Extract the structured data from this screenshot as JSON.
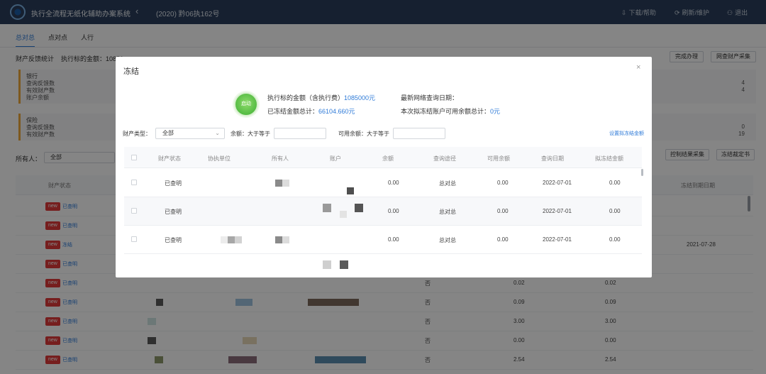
{
  "header": {
    "app_title": "执行全流程无纸化辅助办案系统",
    "case_no": "(2020) 黔06执162号",
    "actions": [
      "下载/帮助",
      "刷新/维护",
      "退出"
    ],
    "action_icons": [
      "download-icon",
      "refresh-icon",
      "user-icon"
    ]
  },
  "page": {
    "tabs": [
      "总对总",
      "点对点",
      "人行"
    ],
    "stat_label": "财产反馈统计",
    "stat_amount_prefix": "执行标的金额：10850",
    "right_buttons": [
      "完成办理",
      "网查财产采集"
    ],
    "bank_box": {
      "title": "银行",
      "lines": [
        "查询反馈数",
        "有效财产数",
        "账户余额"
      ],
      "values": [
        "4",
        "4"
      ]
    },
    "insurance_box": {
      "title": "保险",
      "lines": [
        "查询反馈数",
        "有效财产数"
      ],
      "values": [
        "0",
        "19"
      ]
    },
    "owner_label": "所有人：",
    "owner_value": "全部",
    "small_buttons": [
      "控制结果采集",
      "冻结裁定书"
    ],
    "columns": [
      "财产状态",
      "冻结到期日期"
    ],
    "badge_new": "new",
    "row_status": [
      "已查明",
      "已查明",
      "冻结",
      "已查明",
      "已查明",
      "已查明",
      "已查明",
      "已查明",
      "已查明"
    ],
    "row_date": "2021-07-28",
    "col_no": "否",
    "values_a": [
      "0.02",
      "0.09",
      "3.00",
      "0.00",
      "2.54"
    ],
    "values_b": [
      "0.02",
      "0.09",
      "3.00",
      "0.00",
      "2.54"
    ]
  },
  "modal": {
    "title": "冻结",
    "start_button": "启动",
    "target_amount_label": "执行标的金额（含执行费）",
    "target_amount": "1085000元",
    "frozen_total_label": "已冻结金额总计：",
    "frozen_total": "66104.660元",
    "latest_query_label": "最新网络查询日期：",
    "freezable_label": "本次拟冻结账户可用余额总计：",
    "freezable_total": "0元",
    "filter": {
      "type_label": "财产类型：",
      "type_value": "全部",
      "balance_label": "余额：大于等于",
      "available_label": "可用余额：大于等于",
      "set_link": "设置拟冻结金额"
    },
    "columns": [
      "财产状态",
      "协执单位",
      "所有人",
      "账户",
      "余额",
      "查询途径",
      "可用余额",
      "查询日期",
      "拟冻结金额"
    ],
    "rows": [
      {
        "status": "已查明",
        "balance": "0.00",
        "source": "总对总",
        "available": "0.00",
        "date": "2022-07-01",
        "freeze": "0.00"
      },
      {
        "status": "已查明",
        "balance": "0.00",
        "source": "总对总",
        "available": "0.00",
        "date": "2022-07-01",
        "freeze": "0.00"
      },
      {
        "status": "已查明",
        "balance": "0.00",
        "source": "总对总",
        "available": "0.00",
        "date": "2022-07-01",
        "freeze": "0.00"
      }
    ]
  }
}
